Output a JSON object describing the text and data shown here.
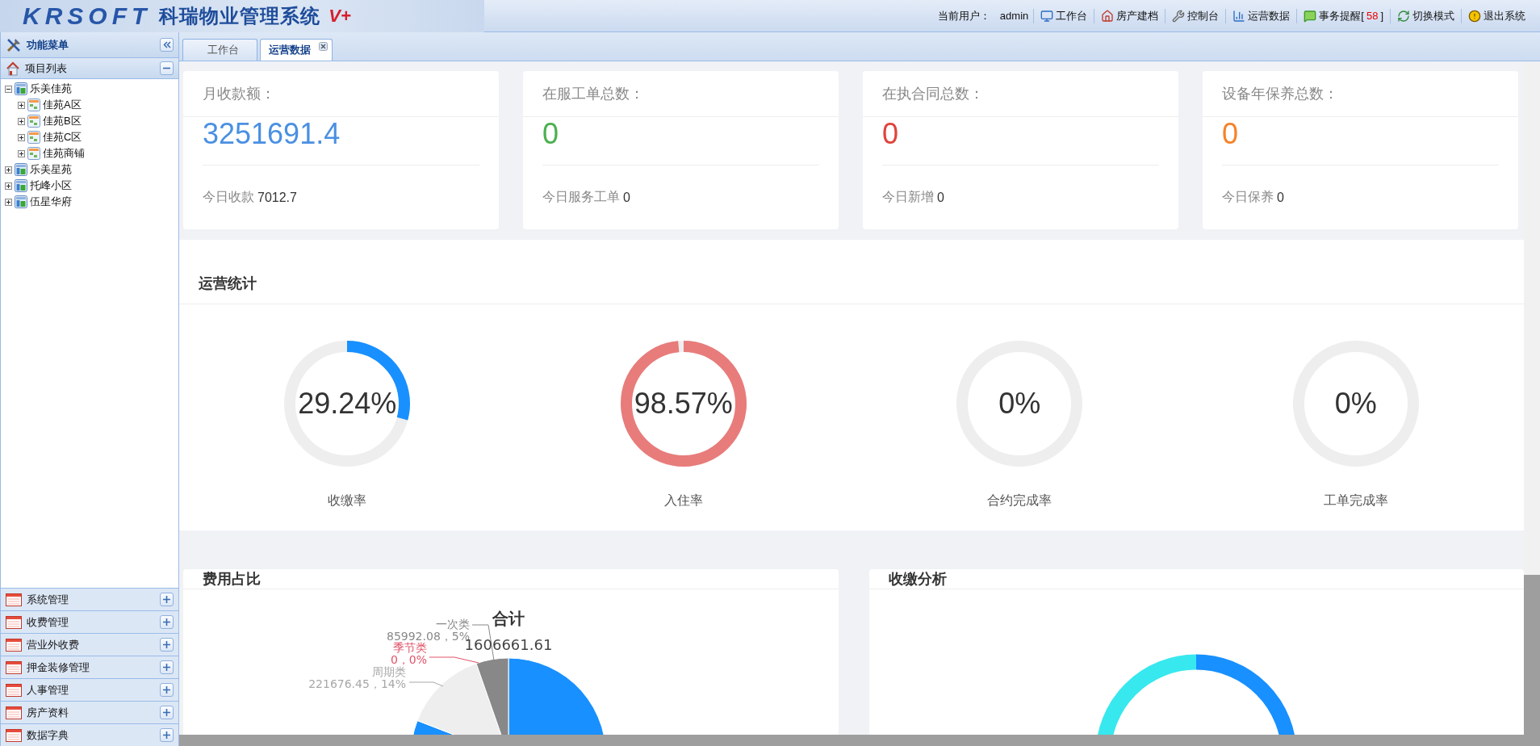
{
  "header": {
    "logo_latin": "KRSOFT",
    "logo_title": "科瑞物业管理系统",
    "logo_version": "V+",
    "user_label": "当前用户：",
    "user": "admin",
    "nav": [
      {
        "label": "工作台"
      },
      {
        "label": "房产建档"
      },
      {
        "label": "控制台"
      },
      {
        "label": "运营数据"
      },
      {
        "label": "事务提醒",
        "count_open": "[",
        "count": "58",
        "count_close": "]"
      },
      {
        "label": "切换模式"
      },
      {
        "label": "退出系统"
      }
    ]
  },
  "sidebar": {
    "title": "功能菜单",
    "project_panel": {
      "title": "项目列表",
      "expanded": true
    },
    "tree": [
      {
        "label": "乐美佳苑",
        "expanded": true,
        "children": [
          {
            "label": "佳苑A区",
            "expanded": false
          },
          {
            "label": "佳苑B区",
            "expanded": false
          },
          {
            "label": "佳苑C区",
            "expanded": false
          },
          {
            "label": "佳苑商铺",
            "expanded": false
          }
        ]
      },
      {
        "label": "乐美星苑",
        "expanded": false
      },
      {
        "label": "托峰小区",
        "expanded": false
      },
      {
        "label": "伍星华府",
        "expanded": false
      }
    ],
    "menus": [
      {
        "label": "系统管理",
        "expanded": false
      },
      {
        "label": "收费管理",
        "expanded": false
      },
      {
        "label": "营业外收费",
        "expanded": false
      },
      {
        "label": "押金装修管理",
        "expanded": false
      },
      {
        "label": "人事管理",
        "expanded": false
      },
      {
        "label": "房产资料",
        "expanded": false
      },
      {
        "label": "数据字典",
        "expanded": false
      }
    ]
  },
  "tabs": [
    {
      "label": "工作台",
      "selected": false,
      "closable": false
    },
    {
      "label": "运营数据",
      "selected": true,
      "closable": true
    }
  ],
  "stat_cards": [
    {
      "title": "月收款额：",
      "value": "3251691.4",
      "color": "#4a90e2",
      "footer_label": "今日收款",
      "footer_value": "7012.7"
    },
    {
      "title": "在服工单总数：",
      "value": "0",
      "color": "#4cb050",
      "footer_label": "今日服务工单",
      "footer_value": "0"
    },
    {
      "title": "在执合同总数：",
      "value": "0",
      "color": "#e0443c",
      "footer_label": "今日新增",
      "footer_value": "0"
    },
    {
      "title": "设备年保养总数：",
      "value": "0",
      "color": "#f5832a",
      "footer_label": "今日保养",
      "footer_value": "0"
    }
  ],
  "operations": {
    "title": "运营统计",
    "gauges": [
      {
        "reading": "29.24%",
        "label": "收缴率",
        "level": 0.2924,
        "color": "#1890ff"
      },
      {
        "reading": "98.57%",
        "label": "入住率",
        "level": 0.9857,
        "color": "#e87c7b"
      },
      {
        "reading": "0%",
        "label": "合约完成率",
        "level": 0
      },
      {
        "reading": "0%",
        "label": "工单完成率",
        "level": 0
      }
    ]
  },
  "fee_share": {
    "title": "费用占比",
    "chart_data": {
      "type": "pie",
      "title": "合计",
      "annotations": [
        {
          "text": "1606661.61"
        }
      ],
      "categories": [
        "一次类",
        "季节类",
        "周期类",
        null
      ],
      "values": [
        85992.08,
        0,
        221676.45,
        1298993.08
      ],
      "colors": [
        "#888888",
        "#e05267",
        "#eeeeee",
        "#1890ff"
      ],
      "value_labels": [
        "85992.08，5%",
        "0，0%",
        "221676.45，14%",
        null
      ]
    }
  },
  "collection": {
    "title": "收缴分析"
  }
}
